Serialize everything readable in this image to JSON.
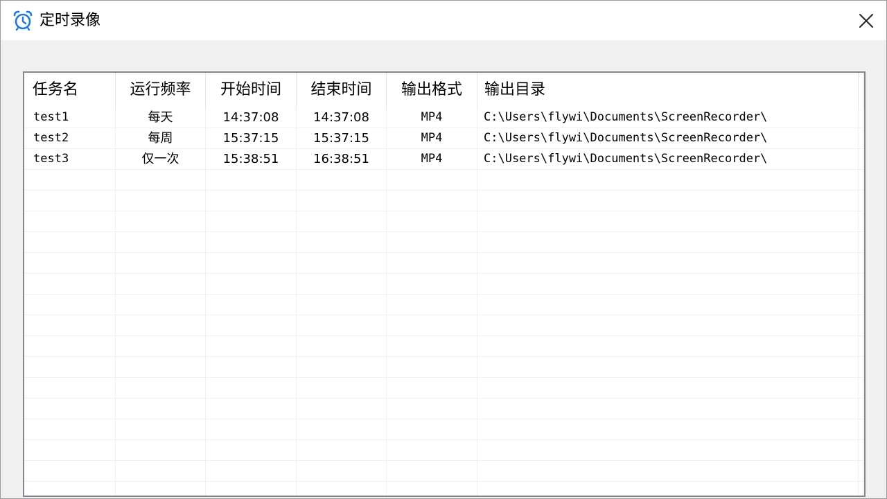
{
  "window": {
    "title": "定时录像",
    "icon": "alarm-clock-icon",
    "accent_color": "#1e7ad6"
  },
  "table": {
    "columns": [
      "任务名",
      "运行频率",
      "开始时间",
      "结束时间",
      "输出格式",
      "输出目录"
    ],
    "rows": [
      {
        "name": "test1",
        "frequency": "每天",
        "start": "14:37:08",
        "end": "14:37:08",
        "format": "MP4",
        "dir": "C:\\Users\\flywi\\Documents\\ScreenRecorder\\"
      },
      {
        "name": "test2",
        "frequency": "每周",
        "start": "15:37:15",
        "end": "15:37:15",
        "format": "MP4",
        "dir": "C:\\Users\\flywi\\Documents\\ScreenRecorder\\"
      },
      {
        "name": "test3",
        "frequency": "仅一次",
        "start": "15:38:51",
        "end": "16:38:51",
        "format": "MP4",
        "dir": "C:\\Users\\flywi\\Documents\\ScreenRecorder\\"
      }
    ]
  }
}
